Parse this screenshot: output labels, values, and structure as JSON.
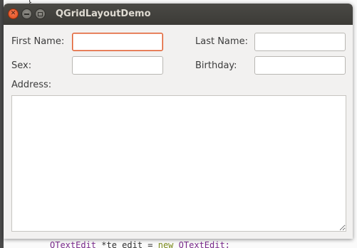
{
  "window": {
    "title": "QGridLayoutDemo"
  },
  "form": {
    "first_name_label": "First Name:",
    "last_name_label": "Last Name:",
    "sex_label": "Sex:",
    "birthday_label": "Birthday:",
    "address_label": "Address:",
    "first_name_value": "",
    "last_name_value": "",
    "sex_value": "",
    "birthday_value": "",
    "address_value": ""
  },
  "background_code": {
    "brace": "}",
    "line_type": "QTextEdit",
    "line_var": " *te_edit = ",
    "line_kw": "new",
    "line_ctor": " QTextEdit;"
  },
  "colors": {
    "focus_border": "#e05a2a",
    "titlebar": "#3c3b37",
    "close_button": "#df4a16"
  }
}
